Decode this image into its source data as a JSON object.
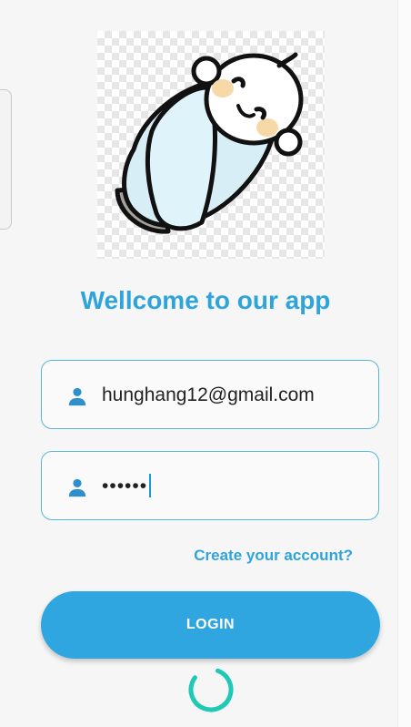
{
  "header": {
    "welcome_title": "Wellcome to our app"
  },
  "email_field": {
    "value": "hunghang12@gmail.com",
    "icon": "person-icon"
  },
  "password_field": {
    "masked_value": "••••••",
    "icon": "person-icon"
  },
  "links": {
    "create_account": "Create your account?"
  },
  "login_button": {
    "label": "LOGIN"
  },
  "colors": {
    "accent": "#2fa4db",
    "field_border": "#57b7d5",
    "spinner": "#1fc9b5"
  }
}
